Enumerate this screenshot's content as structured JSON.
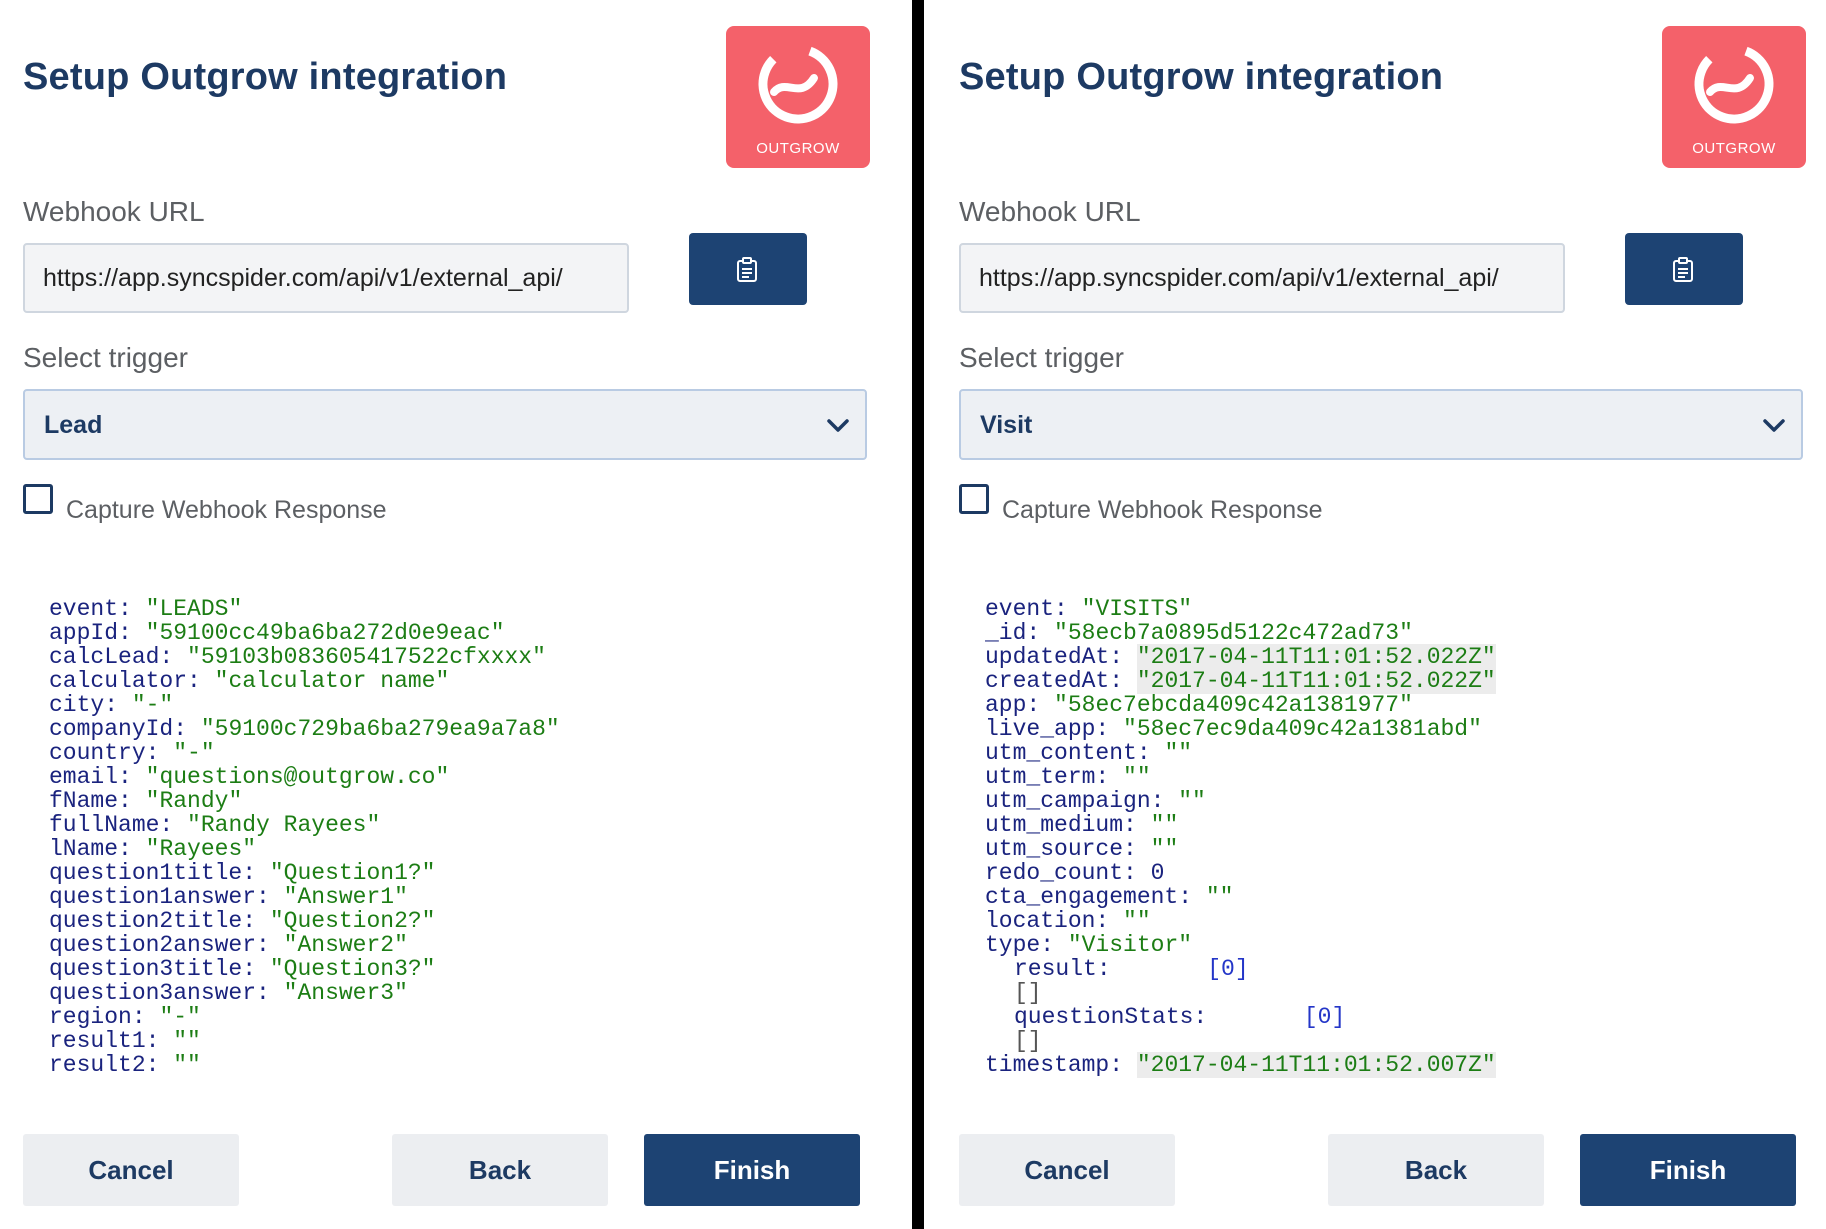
{
  "left": {
    "title": "Setup Outgrow integration",
    "logo_text": "OUTGROW",
    "webhook_label": "Webhook URL",
    "webhook_url": "https://app.syncspider.com/api/v1/external_api/",
    "trigger_label": "Select trigger",
    "trigger_value": "Lead",
    "capture_label": "Capture Webhook Response",
    "capture_checked": false,
    "payload": [
      {
        "k": "event:",
        "v": "\"LEADS\""
      },
      {
        "k": "appId:",
        "v": "\"59100cc49ba6ba272d0e9eac\""
      },
      {
        "k": "calcLead:",
        "v": "\"59103b083605417522cfxxxx\""
      },
      {
        "k": "calculator:",
        "v": "\"calculator name\""
      },
      {
        "k": "city:",
        "v": "\"-\""
      },
      {
        "k": "companyId:",
        "v": "\"59100c729ba6ba279ea9a7a8\""
      },
      {
        "k": "country:",
        "v": "\"-\""
      },
      {
        "k": "email:",
        "v": "\"questions@outgrow.co\""
      },
      {
        "k": "fName:",
        "v": "\"Randy\""
      },
      {
        "k": "fullName:",
        "v": "\"Randy Rayees\""
      },
      {
        "k": "lName:",
        "v": "\"Rayees\""
      },
      {
        "k": "question1title:",
        "v": "\"Question1?\""
      },
      {
        "k": "question1answer:",
        "v": "\"Answer1\""
      },
      {
        "k": "question2title:",
        "v": "\"Question2?\""
      },
      {
        "k": "question2answer:",
        "v": "\"Answer2\""
      },
      {
        "k": "question3title:",
        "v": "\"Question3?\""
      },
      {
        "k": "question3answer:",
        "v": "\"Answer3\""
      },
      {
        "k": "region:",
        "v": "\"-\""
      },
      {
        "k": "result1:",
        "v": "\"\""
      },
      {
        "k": "result2:",
        "v": "\"\""
      }
    ],
    "cancel_label": "Cancel",
    "back_label": "Back",
    "finish_label": "Finish"
  },
  "right": {
    "title": "Setup Outgrow integration",
    "logo_text": "OUTGROW",
    "webhook_label": "Webhook URL",
    "webhook_url": "https://app.syncspider.com/api/v1/external_api/",
    "trigger_label": "Select trigger",
    "trigger_value": "Visit",
    "capture_label": "Capture Webhook Response",
    "capture_checked": false,
    "payload": [
      {
        "k": "event:",
        "v": "\"VISITS\""
      },
      {
        "k": "_id:",
        "v": "\"58ecb7a0895d5122c472ad73\""
      },
      {
        "k": "updatedAt:",
        "v": "\"2017-04-11T11:01:52.022Z\"",
        "hl": true
      },
      {
        "k": "createdAt:",
        "v": "\"2017-04-11T11:01:52.022Z\"",
        "hl": true
      },
      {
        "k": "app:",
        "v": "\"58ec7ebcda409c42a1381977\""
      },
      {
        "k": "live_app:",
        "v": "\"58ec7ec9da409c42a1381abd\""
      },
      {
        "k": "utm_content:",
        "v": "\"\""
      },
      {
        "k": "utm_term:",
        "v": "\"\""
      },
      {
        "k": "utm_campaign:",
        "v": "\"\""
      },
      {
        "k": "utm_medium:",
        "v": "\"\""
      },
      {
        "k": "utm_source:",
        "v": "\"\""
      },
      {
        "k": "redo_count:",
        "n": "0"
      },
      {
        "k": "cta_engagement:",
        "v": "\"\""
      },
      {
        "k": "location:",
        "v": "\"\""
      },
      {
        "k": "type:",
        "v": "\"Visitor\""
      },
      {
        "k": "result:",
        "arr": "[0]",
        "indent": true
      },
      {
        "bracket": "[]",
        "indent": true
      },
      {
        "k": "questionStats:",
        "arr": "[0]",
        "indent": true
      },
      {
        "bracket": "[]",
        "indent": true
      },
      {
        "k": "timestamp:",
        "v": "\"2017-04-11T11:01:52.007Z\"",
        "hl": true
      }
    ],
    "cancel_label": "Cancel",
    "back_label": "Back",
    "finish_label": "Finish"
  },
  "colors": {
    "brand_navy": "#1d3a63",
    "button_navy": "#1d4373",
    "logo_coral": "#f4616a",
    "string_green": "#1c7d14",
    "key_navy": "#1a237e"
  },
  "icons": {
    "copy": "clipboard-icon",
    "select": "chevron-down-icon",
    "logo": "outgrow-logo-icon"
  }
}
